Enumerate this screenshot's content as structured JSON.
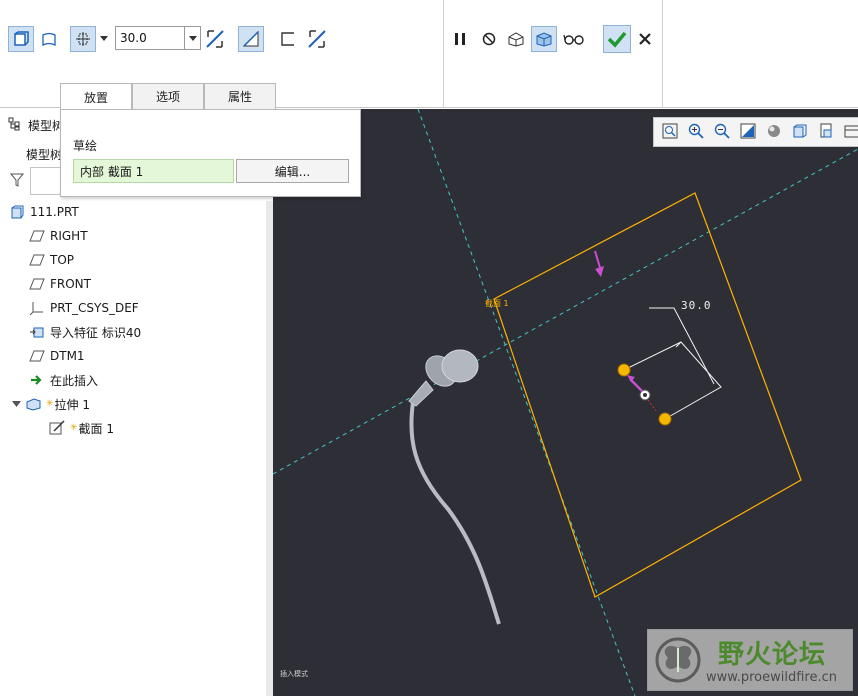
{
  "toolbar": {
    "depth_value": "30.0",
    "confirm_color": "#1f9a2e",
    "accent": "#cfe1f3"
  },
  "tabs": [
    {
      "label": "放置",
      "active": true
    },
    {
      "label": "选项",
      "active": false
    },
    {
      "label": "属性",
      "active": false
    }
  ],
  "panel": {
    "title": "草绘",
    "sketch_value": "内部 截面 1",
    "edit_label": "编辑..."
  },
  "model_tree": {
    "header": "模型树",
    "sub_header": "模型树",
    "items": [
      {
        "label": "111.PRT",
        "icon": "part-icon"
      },
      {
        "label": "RIGHT",
        "icon": "datum-plane-icon"
      },
      {
        "label": "TOP",
        "icon": "datum-plane-icon"
      },
      {
        "label": "FRONT",
        "icon": "datum-plane-icon"
      },
      {
        "label": "PRT_CSYS_DEF",
        "icon": "csys-icon"
      },
      {
        "label": "导入特征 标识40",
        "icon": "import-feature-icon"
      },
      {
        "label": "DTM1",
        "icon": "datum-plane-icon"
      },
      {
        "label": "在此插入",
        "icon": "insert-here-arrow-icon"
      },
      {
        "label": "拉伸 1",
        "icon": "extrude-icon"
      },
      {
        "label": "截面 1",
        "icon": "sketch-icon"
      }
    ]
  },
  "viewport": {
    "dimension": "30.0",
    "section_label": "截面 1",
    "status_text": "插入模式",
    "background": "#2e2e36",
    "sketch_color": "#ffb300"
  },
  "watermark": {
    "title": "野火论坛",
    "url": "www.proewildfire.cn"
  }
}
